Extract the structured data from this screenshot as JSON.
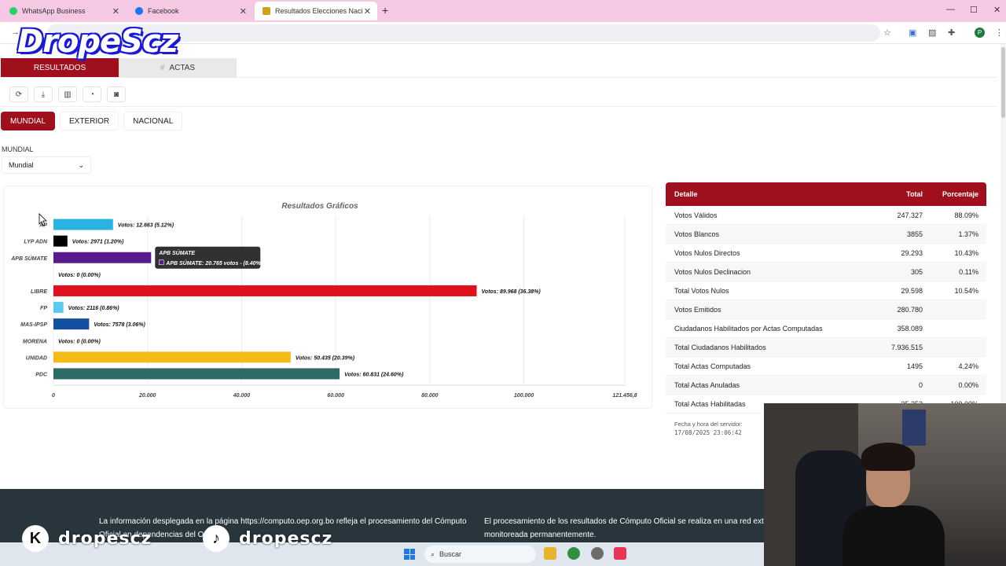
{
  "browser": {
    "tabs": [
      {
        "title": "WhatsApp Business",
        "icon": "whatsapp-icon",
        "color": "#25d366"
      },
      {
        "title": "Facebook",
        "icon": "facebook-icon",
        "color": "#1877f2"
      },
      {
        "title": "Resultados Elecciones Nacional",
        "icon": "oep-icon",
        "color": "#d1a21a"
      }
    ],
    "new_tab": "+",
    "minimize": "—",
    "maximize": "☐",
    "close": "✕",
    "profile": "P"
  },
  "brand": {
    "logo_text": "DropeScz"
  },
  "page_tabs": {
    "results": "RESULTADOS",
    "actas": "ACTAS"
  },
  "toolbar": {
    "refresh": "⟳",
    "download": "⤓",
    "bars": "▥",
    "pie": "◔",
    "camera": "◙"
  },
  "scope": {
    "mundial": "MUNDIAL",
    "exterior": "EXTERIOR",
    "nacional": "NACIONAL"
  },
  "filter": {
    "label": "MUNDIAL",
    "value": "Mundial",
    "chevron": "⌄"
  },
  "chart_data": {
    "type": "bar",
    "orientation": "horizontal",
    "title": "Resultados Gráficos",
    "categories": [
      "AP",
      "LYP ADN",
      "APB SÚMATE",
      "",
      "LIBRE",
      "FP",
      "MAS-IPSP",
      "MORENA",
      "UNIDAD",
      "PDC"
    ],
    "values": [
      12663,
      2971,
      20765,
      0,
      89968,
      2116,
      7578,
      0,
      50435,
      60831
    ],
    "labels": [
      "Votos: 12.663 (5.12%)",
      "Votos: 2971 (1.20%)",
      "",
      "Votos: 0 (0.00%)",
      "Votos: 89.968 (36.38%)",
      "Votos: 2116 (0.86%)",
      "Votos: 7578 (3.06%)",
      "Votos: 0 (0.00%)",
      "Votos: 50.435 (20.39%)",
      "Votos: 60.831 (24.60%)"
    ],
    "colors": [
      "#2ab3e0",
      "#000000",
      "#5b1a8c",
      "#999999",
      "#e1101f",
      "#5bcaf0",
      "#154fa1",
      "#7a1010",
      "#f2bb18",
      "#2e6b66"
    ],
    "xlim": [
      0,
      121456.8
    ],
    "xticks": [
      "0",
      "20.000",
      "40.000",
      "60.000",
      "80.000",
      "100.000",
      "121.456,8"
    ],
    "xtick_values": [
      0,
      20000,
      40000,
      60000,
      80000,
      100000,
      121456.8
    ],
    "grid": true,
    "tooltip": {
      "title": "APB SÚMATE",
      "text": "APB SÚMATE: 20.765 votos - (8.40%)"
    }
  },
  "table": {
    "headers": [
      "Detalle",
      "Total",
      "Porcentaje"
    ],
    "rows": [
      [
        "Votos Válidos",
        "247.327",
        "88.09%"
      ],
      [
        "Votos Blancos",
        "3855",
        "1.37%"
      ],
      [
        "Votos Nulos Directos",
        "29.293",
        "10.43%"
      ],
      [
        "Votos Nulos Declinacion",
        "305",
        "0.11%"
      ],
      [
        "Total Votos Nulos",
        "29.598",
        "10.54%"
      ],
      [
        "Votos Emitidos",
        "280.780",
        ""
      ],
      [
        "Ciudadanos Habilitados por Actas Computadas",
        "358.089",
        ""
      ],
      [
        "Total Ciudadanos Habilitados",
        "7.936.515",
        ""
      ],
      [
        "Total Actas Computadas",
        "1495",
        "4.24%"
      ],
      [
        "Total Actas Anuladas",
        "0",
        "0.00%"
      ],
      [
        "Total Actas Habilitadas",
        "35.253",
        "100.00%"
      ]
    ],
    "server_label": "Fecha y hora del servidor:",
    "server_time": "17/08/2025 23:06:42"
  },
  "footer": {
    "text1": "La información desplegada en la página https://computo.oep.org.bo refleja el procesamiento del Cómputo Oficial en dependencias del OEP.",
    "text2": "El procesamiento de los resultados de Cómputo Oficial se realiza en una red externas y monitoreada permanentemente."
  },
  "watermark": {
    "text": "dropescz",
    "kick_glyph": "K",
    "tiktok_glyph": "♪"
  },
  "taskbar": {
    "search": "Buscar"
  }
}
